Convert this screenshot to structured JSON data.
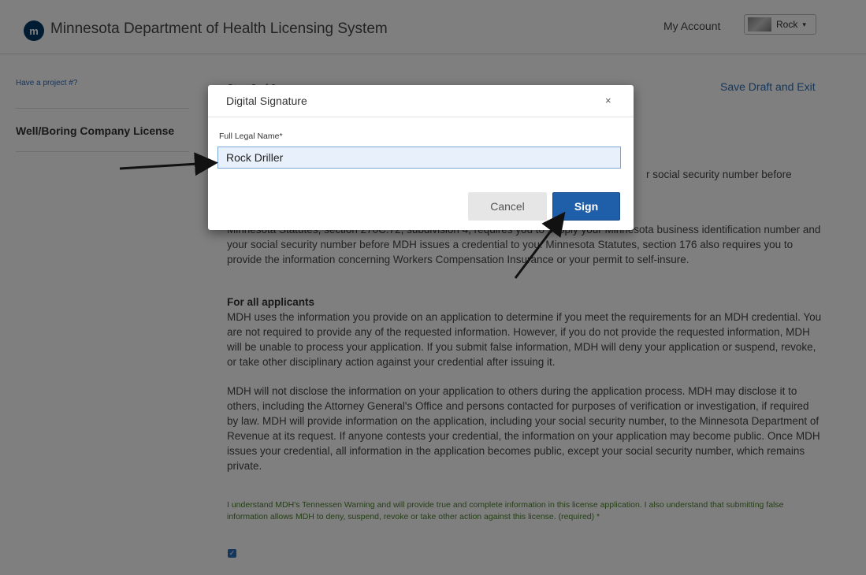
{
  "header": {
    "logo_text": "m",
    "app_title": "Minnesota Department of Health Licensing System",
    "my_account": "My Account",
    "user_name": "Rock"
  },
  "sidebar": {
    "project_link": "Have a project #?",
    "nav_item": "Well/Boring Company License"
  },
  "main": {
    "step": "Step 3 of 9",
    "save_draft": "Save Draft and Exit",
    "line_partial": "r social security number before",
    "para1": "Minnesota Statutes, section 270C.72, subdivision 4, requires you to supply your Minnesota business identification number and your social security number before MDH issues a credential to you. Minnesota Statutes, section 176 also requires you to provide the information concerning Workers Compensation Insurance or your permit to self-insure.",
    "all_applicants_heading": "For all applicants",
    "para2": "MDH uses the information you provide on an application to determine if you meet the requirements for an MDH credential. You are not required to provide any of the requested information. However, if you do not provide the requested information, MDH will be unable to process your application. If you submit false information, MDH will deny your application or suspend, revoke, or take other disciplinary action against your credential after issuing it.",
    "para3": "MDH will not disclose the information on your application to others during the application process. MDH may disclose it to others, including the Attorney General's Office and persons contacted for purposes of verification or investigation, if required by law. MDH will provide information on the application, including your social security number, to the Minnesota Department of Revenue at its request. If anyone contests your credential, the information on your application may become public. Once MDH issues your credential, all information in the application becomes public, except your social security number, which remains private.",
    "consent": "I understand MDH's Tennessen Warning and will provide true and complete information in this license application. I also understand that submitting false information allows MDH to deny, suspend, revoke or take other action against this license. (required) *",
    "consent_checked": true
  },
  "modal": {
    "title": "Digital Signature",
    "close": "×",
    "field_label": "Full Legal Name*",
    "field_value": "Rock Driller",
    "cancel": "Cancel",
    "sign": "Sign"
  },
  "colors": {
    "brand": "#003865",
    "link": "#2a6ebb",
    "primary_button": "#1f5ea8",
    "consent_text": "#4a7f2b"
  }
}
